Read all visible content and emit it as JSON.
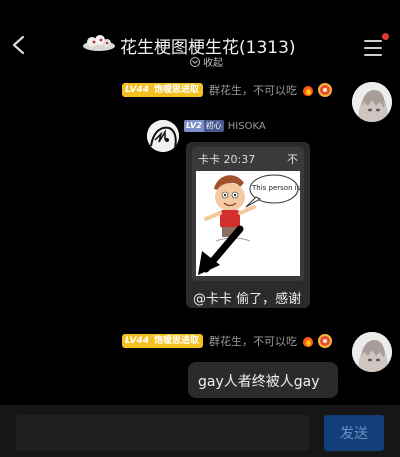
{
  "header": {
    "title": "花生梗图梗生花(1313)",
    "collapse_label": "收起"
  },
  "messages": [
    {
      "level": "LV44",
      "tag": "饱嗳思进取",
      "group_nick": "群花生，不可以吃"
    },
    {
      "level": "LV2",
      "tag": "初心",
      "nick": "HISOKA",
      "quote": {
        "sender": "卡卡",
        "time": "20:37",
        "status": "不",
        "meme_text": "This person is gay"
      },
      "text": "@卡卡 偷了，感谢"
    },
    {
      "level": "LV44",
      "tag": "饱嗳思进取",
      "group_nick": "群花生，不可以吃",
      "text": "gay人者终被人gay"
    }
  ],
  "input": {
    "placeholder": "",
    "send_label": "发送"
  },
  "colors": {
    "background": "#000000",
    "bubble": "#2b2b2b",
    "level_gold": "#f4c021",
    "send_button": "#123f79",
    "unread_dot": "#e53935"
  },
  "icons": {
    "back": "chevron-left-icon",
    "menu": "hamburger-menu-icon",
    "collapse": "chevron-down-circle-icon"
  }
}
